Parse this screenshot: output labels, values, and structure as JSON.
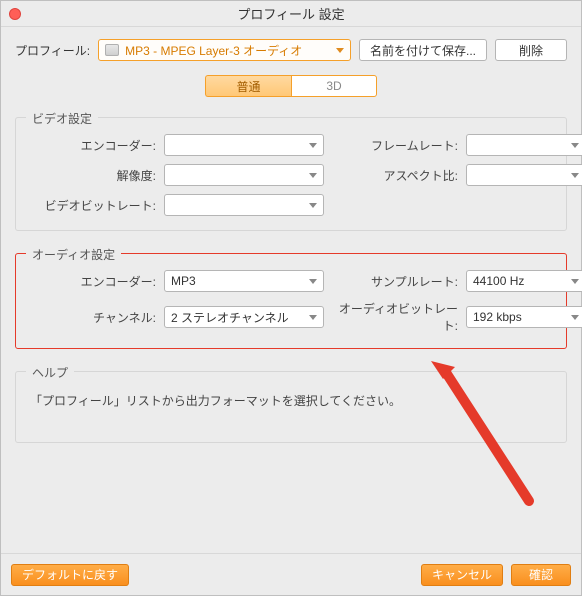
{
  "window": {
    "title": "プロフィール 設定"
  },
  "profile": {
    "label": "プロフィール:",
    "selected": "MP3 - MPEG Layer-3 オーディオ",
    "saveAs": "名前を付けて保存...",
    "delete": "削除"
  },
  "tabs": {
    "normal": "普通",
    "threeD": "3D"
  },
  "video": {
    "legend": "ビデオ設定",
    "encoderLabel": "エンコーダー:",
    "encoder": "",
    "frameRateLabel": "フレームレート:",
    "frameRate": "",
    "resolutionLabel": "解像度:",
    "resolution": "",
    "aspectLabel": "アスペクト比:",
    "aspect": "",
    "bitrateLabel": "ビデオビットレート:",
    "bitrate": ""
  },
  "audio": {
    "legend": "オーディオ設定",
    "encoderLabel": "エンコーダー:",
    "encoder": "MP3",
    "sampleRateLabel": "サンプルレート:",
    "sampleRate": "44100 Hz",
    "channelLabel": "チャンネル:",
    "channel": "2 ステレオチャンネル",
    "bitrateLabel": "オーディオビットレート:",
    "bitrate": "192 kbps"
  },
  "help": {
    "legend": "ヘルプ",
    "text": "「プロフィール」リストから出力フォーマットを選択してください。"
  },
  "footer": {
    "defaults": "デフォルトに戻す",
    "cancel": "キャンセル",
    "ok": "確認"
  }
}
